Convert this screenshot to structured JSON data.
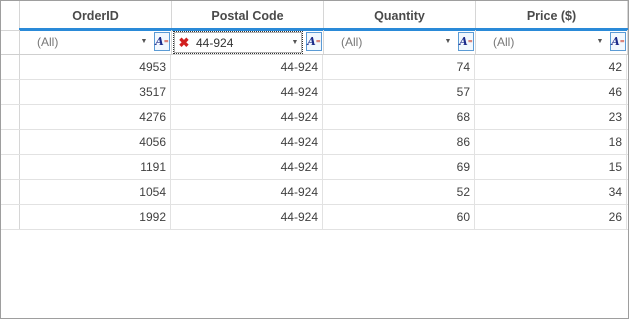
{
  "columns": [
    {
      "header": "OrderID"
    },
    {
      "header": "Postal Code"
    },
    {
      "header": "Quantity"
    },
    {
      "header": "Price ($)"
    }
  ],
  "filters": [
    {
      "value": "(All)",
      "active": false
    },
    {
      "value": "44-924",
      "active": true
    },
    {
      "value": "(All)",
      "active": false
    },
    {
      "value": "(All)",
      "active": false
    }
  ],
  "filter_operator_glyph": "A",
  "rows": [
    [
      "4953",
      "44-924",
      "74",
      "42"
    ],
    [
      "3517",
      "44-924",
      "57",
      "46"
    ],
    [
      "4276",
      "44-924",
      "68",
      "23"
    ],
    [
      "4056",
      "44-924",
      "86",
      "18"
    ],
    [
      "1191",
      "44-924",
      "69",
      "15"
    ],
    [
      "1054",
      "44-924",
      "52",
      "34"
    ],
    [
      "1992",
      "44-924",
      "60",
      "26"
    ]
  ],
  "accent_color": "#2a8ad8"
}
